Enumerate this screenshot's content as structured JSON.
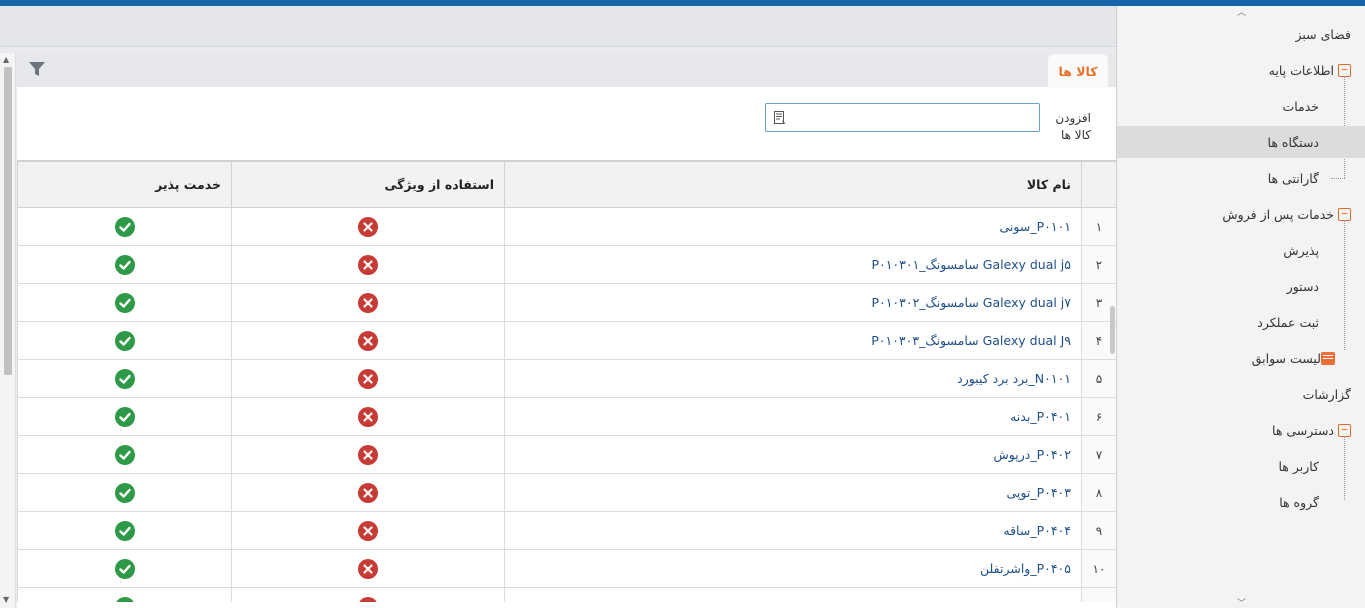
{
  "sidebar": {
    "items": [
      {
        "label": "فضای سبز",
        "level": 0
      },
      {
        "label": "اطلاعات پایه",
        "level": 0,
        "expandable": true
      },
      {
        "label": "خدمات",
        "level": 1
      },
      {
        "label": "دستگاه ها",
        "level": 1,
        "active": true
      },
      {
        "label": "گارانتی ها",
        "level": 1
      },
      {
        "label": "خدمات پس از فروش",
        "level": 0,
        "expandable": true
      },
      {
        "label": "پذیرش",
        "level": 1
      },
      {
        "label": "دستور",
        "level": 1
      },
      {
        "label": "ثبت عملکرد",
        "level": 1
      },
      {
        "label": "لیست سوابق",
        "level": 1,
        "icon": "history-icon"
      },
      {
        "label": "گزارشات",
        "level": 0
      },
      {
        "label": "دسترسی ها",
        "level": 0,
        "expandable": true
      },
      {
        "label": "کاربر ها",
        "level": 1
      },
      {
        "label": "گروه ها",
        "level": 1
      }
    ]
  },
  "tab": {
    "label": "کالا ها"
  },
  "add": {
    "label": "افزودن کالا ها",
    "placeholder": ""
  },
  "table": {
    "columns": [
      "نام کالا",
      "استفاده از ویژگی",
      "خدمت پذیر"
    ],
    "rows": [
      {
        "num": "۱",
        "name": "P۰۱۰۱_سونی",
        "feature": false,
        "service": true
      },
      {
        "num": "۲",
        "name": "Galexy dual j۵ سامسونگ_P۰۱۰۳۰۱",
        "feature": false,
        "service": true
      },
      {
        "num": "۳",
        "name": "Galexy dual j۷ سامسونگ_P۰۱۰۳۰۲",
        "feature": false,
        "service": true
      },
      {
        "num": "۴",
        "name": "Galexy dual J۹ سامسونگ_P۰۱۰۳۰۳",
        "feature": false,
        "service": true
      },
      {
        "num": "۵",
        "name": "N۰۱۰۱_برد برد کیبورد",
        "feature": false,
        "service": true
      },
      {
        "num": "۶",
        "name": "P۰۴۰۱_بدنه",
        "feature": false,
        "service": true
      },
      {
        "num": "۷",
        "name": "P۰۴۰۲_درپوش",
        "feature": false,
        "service": true
      },
      {
        "num": "۸",
        "name": "P۰۴۰۳_توپی",
        "feature": false,
        "service": true
      },
      {
        "num": "۹",
        "name": "P۰۴۰۴_ساقه",
        "feature": false,
        "service": true
      },
      {
        "num": "۱۰",
        "name": "P۰۴۰۵_واشرتفلن",
        "feature": false,
        "service": true
      },
      {
        "num": "",
        "name": "",
        "feature": false,
        "service": true
      }
    ]
  },
  "colors": {
    "accent": "#e8702a",
    "topbar": "#1565a8",
    "ok": "#2e9a47",
    "no": "#c73b37",
    "link": "#1f4f8a"
  }
}
